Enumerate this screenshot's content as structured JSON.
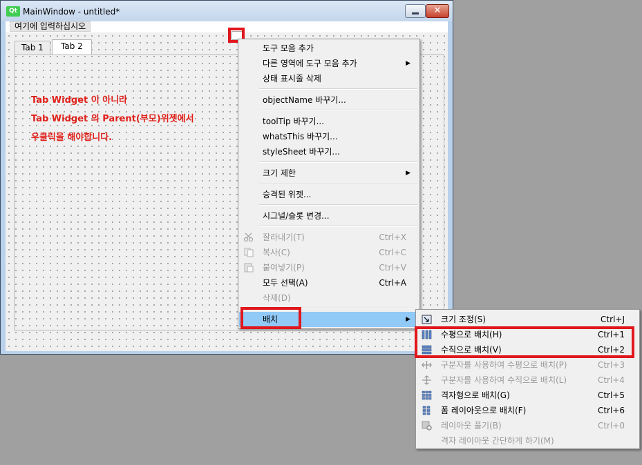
{
  "window": {
    "logo_text": "Qt",
    "title": "MainWindow - untitled*",
    "close_glyph": "✕"
  },
  "menubar": {
    "placeholder_item": "여기에 입력하십시오"
  },
  "tabs": [
    {
      "label": "Tab 1"
    },
    {
      "label": "Tab 2"
    }
  ],
  "annotation": {
    "lines": [
      "Tab Widget 이 아니라",
      "Tab Widget 의 Parent(부모)위젯에서",
      "우클릭을 해야합니다."
    ],
    "color": "#e0201a"
  },
  "context_menu": {
    "items": [
      {
        "label": "도구 모음 추가"
      },
      {
        "label": "다른 영역에 도구 모음 추가",
        "submenu": true
      },
      {
        "label": "상태 표시줄 삭제"
      },
      {
        "label": "objectName 바꾸기..."
      },
      {
        "label": "toolTip 바꾸기..."
      },
      {
        "label": "whatsThis 바꾸기..."
      },
      {
        "label": "styleSheet 바꾸기..."
      },
      {
        "label": "크기 제한",
        "submenu": true
      },
      {
        "label": "승격된 위젯..."
      },
      {
        "label": "시그널/슬롯 변경..."
      },
      {
        "label": "잘라내기(T)",
        "shortcut": "Ctrl+X",
        "disabled": true,
        "icon": "scissors-icon"
      },
      {
        "label": "복사(C)",
        "shortcut": "Ctrl+C",
        "disabled": true,
        "icon": "copy-icon"
      },
      {
        "label": "붙여넣기(P)",
        "shortcut": "Ctrl+V",
        "disabled": true,
        "icon": "paste-icon"
      },
      {
        "label": "모두 선택(A)",
        "shortcut": "Ctrl+A"
      },
      {
        "label": "삭제(D)",
        "disabled": true
      },
      {
        "label": "배치",
        "submenu": true,
        "active": true
      }
    ],
    "submenu_arrow": "▶"
  },
  "layout_submenu": {
    "items": [
      {
        "label": "크기 조정(S)",
        "shortcut": "Ctrl+J",
        "icon": "adjust-size-icon"
      },
      {
        "label": "수평으로 배치(H)",
        "shortcut": "Ctrl+1",
        "icon": "layout-horizontal-icon"
      },
      {
        "label": "수직으로 배치(V)",
        "shortcut": "Ctrl+2",
        "icon": "layout-vertical-icon"
      },
      {
        "label": "구분자를 사용하여 수평으로 배치(P)",
        "shortcut": "Ctrl+3",
        "disabled": true,
        "icon": "splitter-horizontal-icon"
      },
      {
        "label": "구분자를 사용하여 수직으로 배치(L)",
        "shortcut": "Ctrl+4",
        "disabled": true,
        "icon": "splitter-vertical-icon"
      },
      {
        "label": "격자형으로 배치(G)",
        "shortcut": "Ctrl+5",
        "icon": "layout-grid-icon"
      },
      {
        "label": "폼 레이아웃으로 배치(F)",
        "shortcut": "Ctrl+6",
        "icon": "layout-form-icon"
      },
      {
        "label": "레이아웃 풀기(B)",
        "shortcut": "Ctrl+0",
        "disabled": true,
        "icon": "break-layout-icon"
      },
      {
        "label": "격자 레이아웃 간단하게 하기(M)",
        "disabled": true
      }
    ]
  },
  "colors": {
    "highlight_box": "#e0171c",
    "menu_active_bg": "#91c9f7"
  }
}
